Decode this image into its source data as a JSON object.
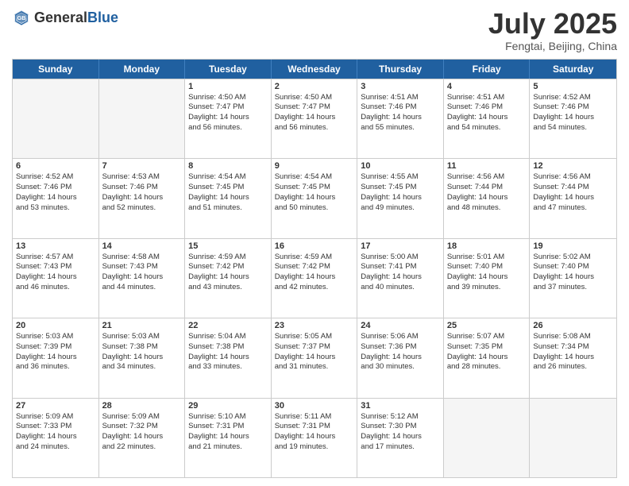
{
  "header": {
    "logo_general": "General",
    "logo_blue": "Blue",
    "title": "July 2025",
    "subtitle": "Fengtai, Beijing, China"
  },
  "days": [
    "Sunday",
    "Monday",
    "Tuesday",
    "Wednesday",
    "Thursday",
    "Friday",
    "Saturday"
  ],
  "weeks": [
    [
      {
        "num": "",
        "lines": [],
        "empty": true
      },
      {
        "num": "",
        "lines": [],
        "empty": true
      },
      {
        "num": "1",
        "lines": [
          "Sunrise: 4:50 AM",
          "Sunset: 7:47 PM",
          "Daylight: 14 hours",
          "and 56 minutes."
        ]
      },
      {
        "num": "2",
        "lines": [
          "Sunrise: 4:50 AM",
          "Sunset: 7:47 PM",
          "Daylight: 14 hours",
          "and 56 minutes."
        ]
      },
      {
        "num": "3",
        "lines": [
          "Sunrise: 4:51 AM",
          "Sunset: 7:46 PM",
          "Daylight: 14 hours",
          "and 55 minutes."
        ]
      },
      {
        "num": "4",
        "lines": [
          "Sunrise: 4:51 AM",
          "Sunset: 7:46 PM",
          "Daylight: 14 hours",
          "and 54 minutes."
        ]
      },
      {
        "num": "5",
        "lines": [
          "Sunrise: 4:52 AM",
          "Sunset: 7:46 PM",
          "Daylight: 14 hours",
          "and 54 minutes."
        ]
      }
    ],
    [
      {
        "num": "6",
        "lines": [
          "Sunrise: 4:52 AM",
          "Sunset: 7:46 PM",
          "Daylight: 14 hours",
          "and 53 minutes."
        ]
      },
      {
        "num": "7",
        "lines": [
          "Sunrise: 4:53 AM",
          "Sunset: 7:46 PM",
          "Daylight: 14 hours",
          "and 52 minutes."
        ]
      },
      {
        "num": "8",
        "lines": [
          "Sunrise: 4:54 AM",
          "Sunset: 7:45 PM",
          "Daylight: 14 hours",
          "and 51 minutes."
        ]
      },
      {
        "num": "9",
        "lines": [
          "Sunrise: 4:54 AM",
          "Sunset: 7:45 PM",
          "Daylight: 14 hours",
          "and 50 minutes."
        ]
      },
      {
        "num": "10",
        "lines": [
          "Sunrise: 4:55 AM",
          "Sunset: 7:45 PM",
          "Daylight: 14 hours",
          "and 49 minutes."
        ]
      },
      {
        "num": "11",
        "lines": [
          "Sunrise: 4:56 AM",
          "Sunset: 7:44 PM",
          "Daylight: 14 hours",
          "and 48 minutes."
        ]
      },
      {
        "num": "12",
        "lines": [
          "Sunrise: 4:56 AM",
          "Sunset: 7:44 PM",
          "Daylight: 14 hours",
          "and 47 minutes."
        ]
      }
    ],
    [
      {
        "num": "13",
        "lines": [
          "Sunrise: 4:57 AM",
          "Sunset: 7:43 PM",
          "Daylight: 14 hours",
          "and 46 minutes."
        ]
      },
      {
        "num": "14",
        "lines": [
          "Sunrise: 4:58 AM",
          "Sunset: 7:43 PM",
          "Daylight: 14 hours",
          "and 44 minutes."
        ]
      },
      {
        "num": "15",
        "lines": [
          "Sunrise: 4:59 AM",
          "Sunset: 7:42 PM",
          "Daylight: 14 hours",
          "and 43 minutes."
        ]
      },
      {
        "num": "16",
        "lines": [
          "Sunrise: 4:59 AM",
          "Sunset: 7:42 PM",
          "Daylight: 14 hours",
          "and 42 minutes."
        ]
      },
      {
        "num": "17",
        "lines": [
          "Sunrise: 5:00 AM",
          "Sunset: 7:41 PM",
          "Daylight: 14 hours",
          "and 40 minutes."
        ]
      },
      {
        "num": "18",
        "lines": [
          "Sunrise: 5:01 AM",
          "Sunset: 7:40 PM",
          "Daylight: 14 hours",
          "and 39 minutes."
        ]
      },
      {
        "num": "19",
        "lines": [
          "Sunrise: 5:02 AM",
          "Sunset: 7:40 PM",
          "Daylight: 14 hours",
          "and 37 minutes."
        ]
      }
    ],
    [
      {
        "num": "20",
        "lines": [
          "Sunrise: 5:03 AM",
          "Sunset: 7:39 PM",
          "Daylight: 14 hours",
          "and 36 minutes."
        ]
      },
      {
        "num": "21",
        "lines": [
          "Sunrise: 5:03 AM",
          "Sunset: 7:38 PM",
          "Daylight: 14 hours",
          "and 34 minutes."
        ]
      },
      {
        "num": "22",
        "lines": [
          "Sunrise: 5:04 AM",
          "Sunset: 7:38 PM",
          "Daylight: 14 hours",
          "and 33 minutes."
        ]
      },
      {
        "num": "23",
        "lines": [
          "Sunrise: 5:05 AM",
          "Sunset: 7:37 PM",
          "Daylight: 14 hours",
          "and 31 minutes."
        ]
      },
      {
        "num": "24",
        "lines": [
          "Sunrise: 5:06 AM",
          "Sunset: 7:36 PM",
          "Daylight: 14 hours",
          "and 30 minutes."
        ]
      },
      {
        "num": "25",
        "lines": [
          "Sunrise: 5:07 AM",
          "Sunset: 7:35 PM",
          "Daylight: 14 hours",
          "and 28 minutes."
        ]
      },
      {
        "num": "26",
        "lines": [
          "Sunrise: 5:08 AM",
          "Sunset: 7:34 PM",
          "Daylight: 14 hours",
          "and 26 minutes."
        ]
      }
    ],
    [
      {
        "num": "27",
        "lines": [
          "Sunrise: 5:09 AM",
          "Sunset: 7:33 PM",
          "Daylight: 14 hours",
          "and 24 minutes."
        ]
      },
      {
        "num": "28",
        "lines": [
          "Sunrise: 5:09 AM",
          "Sunset: 7:32 PM",
          "Daylight: 14 hours",
          "and 22 minutes."
        ]
      },
      {
        "num": "29",
        "lines": [
          "Sunrise: 5:10 AM",
          "Sunset: 7:31 PM",
          "Daylight: 14 hours",
          "and 21 minutes."
        ]
      },
      {
        "num": "30",
        "lines": [
          "Sunrise: 5:11 AM",
          "Sunset: 7:31 PM",
          "Daylight: 14 hours",
          "and 19 minutes."
        ]
      },
      {
        "num": "31",
        "lines": [
          "Sunrise: 5:12 AM",
          "Sunset: 7:30 PM",
          "Daylight: 14 hours",
          "and 17 minutes."
        ]
      },
      {
        "num": "",
        "lines": [],
        "empty": true
      },
      {
        "num": "",
        "lines": [],
        "empty": true
      }
    ]
  ]
}
